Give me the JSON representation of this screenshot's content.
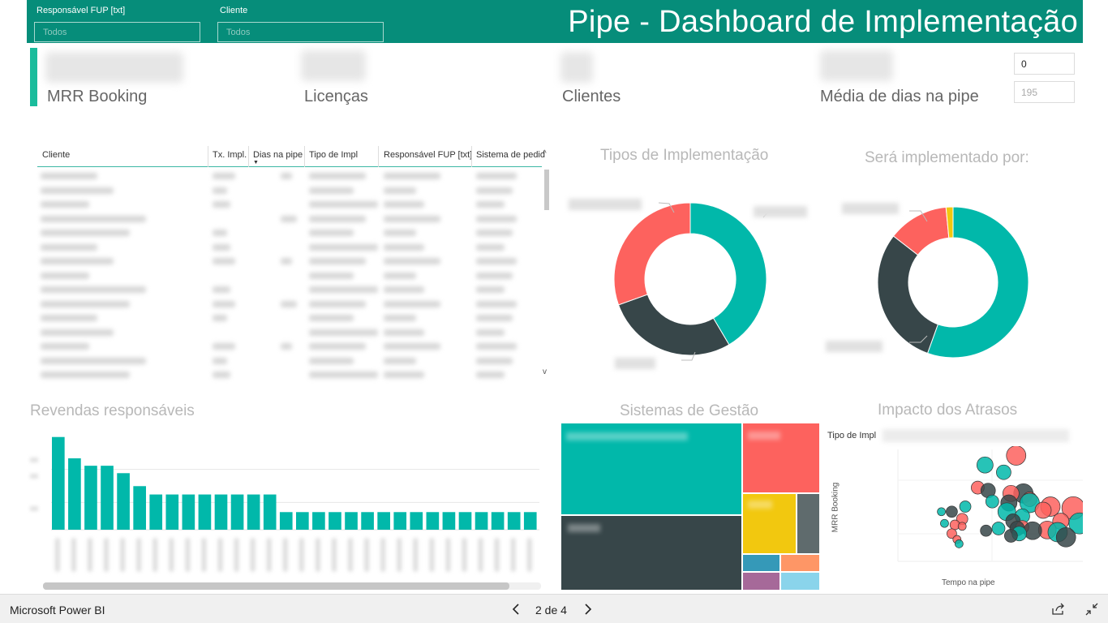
{
  "header": {
    "title": "Pipe - Dashboard de Implementação",
    "slicer_responsavel": {
      "label": "Responsável FUP [txt]",
      "value": "Todos"
    },
    "slicer_cliente": {
      "label": "Cliente",
      "value": "Todos"
    },
    "background": "#068d7a"
  },
  "kpis": {
    "mrr": {
      "label": "MRR Booking"
    },
    "licencas": {
      "label": "Licenças"
    },
    "clientes": {
      "label": "Clientes"
    },
    "media_dias": {
      "label": "Média de dias na pipe"
    }
  },
  "range_filter": {
    "min_value": "0",
    "max_value": "195"
  },
  "table": {
    "columns": [
      "Cliente",
      "Tx. Impl.",
      "Dias na pipe",
      "Tipo de Impl",
      "Responsável FUP [txt]",
      "Sistema de pedid"
    ],
    "sorted_column": "Dias na pipe"
  },
  "visuals": {
    "tipos_impl": {
      "title": "Tipos de Implementação"
    },
    "implementado_por": {
      "title": "Será implementado por:"
    },
    "revendas": {
      "title": "Revendas responsáveis"
    },
    "sistemas": {
      "title": "Sistemas de Gestão"
    },
    "impacto": {
      "title": "Impacto dos Atrasos",
      "legend_title": "Tipo de Impl",
      "x_axis": "Tempo na pipe",
      "y_axis": "MRR Booking"
    }
  },
  "chart_data": [
    {
      "type": "pie",
      "title": "Tipos de Implementação",
      "slices": [
        0.415,
        0.28,
        0.305
      ],
      "colors": [
        "#01b8aa",
        "#374649",
        "#fd625e"
      ]
    },
    {
      "type": "pie",
      "title": "Será implementado por:",
      "slices": [
        0.555,
        0.3,
        0.13,
        0.015
      ],
      "colors": [
        "#01b8aa",
        "#374649",
        "#fd625e",
        "#f2c80f"
      ]
    },
    {
      "type": "bar",
      "title": "Revendas responsáveis",
      "values": [
        100,
        77,
        69,
        69,
        61,
        47,
        38,
        38,
        38,
        38,
        38,
        38,
        38,
        38,
        19,
        19,
        19,
        19,
        19,
        19,
        19,
        19,
        19,
        19,
        19,
        19,
        19,
        19,
        19,
        19
      ],
      "ylim": [
        0,
        105
      ],
      "color": "#01b8aa"
    },
    {
      "type": "treemap",
      "title": "Sistemas de Gestão",
      "cells": [
        {
          "weight": 0.33,
          "color": "#01b8aa"
        },
        {
          "weight": 0.26,
          "color": "#374649"
        },
        {
          "weight": 0.13,
          "color": "#fd625e"
        },
        {
          "weight": 0.1,
          "color": "#f2c80f"
        },
        {
          "weight": 0.03,
          "color": "#5f6b6d"
        },
        {
          "weight": 0.03,
          "color": "#8ad4eb"
        },
        {
          "weight": 0.03,
          "color": "#fe9666"
        },
        {
          "weight": 0.02,
          "color": "#a66999"
        },
        {
          "weight": 0.02,
          "color": "#3599b8"
        }
      ]
    },
    {
      "type": "scatter",
      "title": "Impacto dos Atrasos",
      "xlabel": "Tempo na pipe",
      "ylabel": "MRR Booking",
      "colors": {
        "teal": "#01b8aa",
        "dark": "#374649",
        "red": "#fd625e"
      },
      "points": [
        {
          "x": 117,
          "y": 145,
          "r": 12,
          "c": "red"
        },
        {
          "x": 87,
          "y": 132,
          "r": 10,
          "c": "teal"
        },
        {
          "x": 105,
          "y": 122,
          "r": 9,
          "c": "teal"
        },
        {
          "x": 80,
          "y": 101,
          "r": 8,
          "c": "red"
        },
        {
          "x": 90,
          "y": 97,
          "r": 9,
          "c": "dark"
        },
        {
          "x": 124,
          "y": 93,
          "r": 12,
          "c": "dark"
        },
        {
          "x": 112,
          "y": 93,
          "r": 10,
          "c": "red"
        },
        {
          "x": 130,
          "y": 85,
          "r": 9,
          "c": "red"
        },
        {
          "x": 94,
          "y": 82,
          "r": 8,
          "c": "teal"
        },
        {
          "x": 110,
          "y": 80,
          "r": 10,
          "c": "dark"
        },
        {
          "x": 130,
          "y": 80,
          "r": 12,
          "c": "teal"
        },
        {
          "x": 150,
          "y": 75,
          "r": 12,
          "c": "red"
        },
        {
          "x": 172,
          "y": 73,
          "r": 14,
          "c": "red"
        },
        {
          "x": 143,
          "y": 70,
          "r": 10,
          "c": "red"
        },
        {
          "x": 68,
          "y": 75,
          "r": 7,
          "c": "teal"
        },
        {
          "x": 55,
          "y": 68,
          "r": 7,
          "c": "dark"
        },
        {
          "x": 45,
          "y": 68,
          "r": 5,
          "c": "teal"
        },
        {
          "x": 108,
          "y": 68,
          "r": 11,
          "c": "teal"
        },
        {
          "x": 123,
          "y": 62,
          "r": 9,
          "c": "teal"
        },
        {
          "x": 65,
          "y": 58,
          "r": 7,
          "c": "red"
        },
        {
          "x": 160,
          "y": 55,
          "r": 10,
          "c": "red"
        },
        {
          "x": 114,
          "y": 55,
          "r": 9,
          "c": "dark"
        },
        {
          "x": 123,
          "y": 47,
          "r": 8,
          "c": "red"
        },
        {
          "x": 118,
          "y": 45,
          "r": 9,
          "c": "dark"
        },
        {
          "x": 147,
          "y": 43,
          "r": 11,
          "c": "red"
        },
        {
          "x": 133,
          "y": 42,
          "r": 11,
          "c": "dark"
        },
        {
          "x": 178,
          "y": 52,
          "r": 13,
          "c": "teal"
        },
        {
          "x": 100,
          "y": 45,
          "r": 8,
          "c": "teal"
        },
        {
          "x": 48,
          "y": 52,
          "r": 5,
          "c": "teal"
        },
        {
          "x": 58,
          "y": 50,
          "r": 6,
          "c": "red"
        },
        {
          "x": 65,
          "y": 48,
          "r": 5,
          "c": "red"
        },
        {
          "x": 88,
          "y": 42,
          "r": 7,
          "c": "dark"
        },
        {
          "x": 120,
          "y": 38,
          "r": 9,
          "c": "teal"
        },
        {
          "x": 112,
          "y": 35,
          "r": 8,
          "c": "dark"
        },
        {
          "x": 55,
          "y": 38,
          "r": 6,
          "c": "red"
        },
        {
          "x": 60,
          "y": 30,
          "r": 5,
          "c": "red"
        },
        {
          "x": 62,
          "y": 24,
          "r": 5,
          "c": "teal"
        },
        {
          "x": 157,
          "y": 40,
          "r": 12,
          "c": "teal"
        },
        {
          "x": 165,
          "y": 33,
          "r": 12,
          "c": "dark"
        }
      ]
    }
  ],
  "bottom_bar": {
    "app_name": "Microsoft Power BI",
    "page_indicator": "2 de 4"
  }
}
